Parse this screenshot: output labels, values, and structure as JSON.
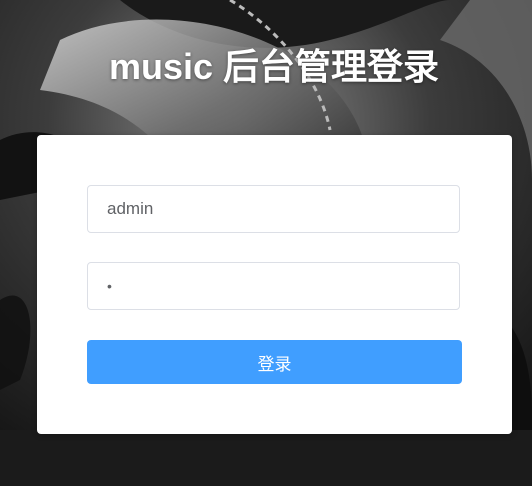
{
  "page": {
    "title": "music 后台管理登录"
  },
  "form": {
    "username_value": "admin",
    "password_mask": "•",
    "login_label": "登录"
  },
  "colors": {
    "primary": "#409eff",
    "border": "#dcdfe6",
    "text": "#606266",
    "card_bg": "#ffffff"
  }
}
